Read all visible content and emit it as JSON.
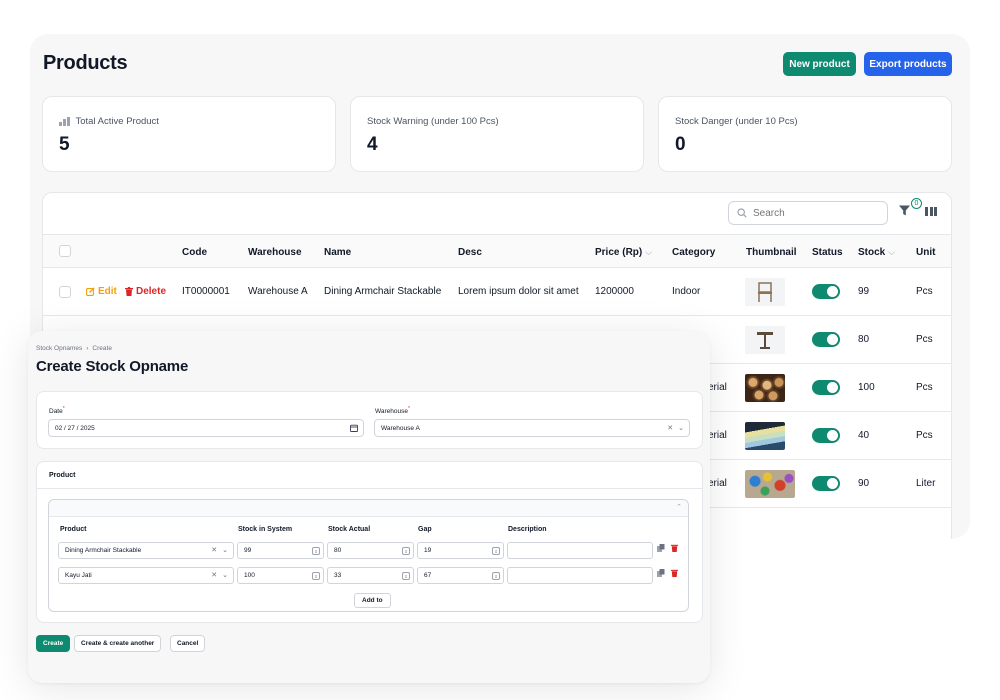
{
  "products_page": {
    "title": "Products",
    "new_button": "New product",
    "export_button": "Export products",
    "stats": [
      {
        "label": "Total Active Product",
        "value": "5",
        "icon": "bar-chart-icon"
      },
      {
        "label": "Stock Warning (under 100 Pcs)",
        "value": "4"
      },
      {
        "label": "Stock Danger (under 10 Pcs)",
        "value": "0"
      }
    ],
    "search_placeholder": "Search",
    "filter_count": "0",
    "columns": [
      "Code",
      "Warehouse",
      "Name",
      "Desc",
      "Price (Rp)",
      "Category",
      "Thumbnail",
      "Status",
      "Stock",
      "Unit"
    ],
    "row_actions": {
      "edit": "Edit",
      "delete": "Delete"
    },
    "rows": [
      {
        "code": "IT0000001",
        "warehouse": "Warehouse A",
        "name": "Dining Armchair Stackable",
        "desc": "Lorem ipsum dolor sit amet",
        "price": "1200000",
        "category": "Indoor",
        "status_on": true,
        "stock": "99",
        "unit": "Pcs"
      },
      {
        "category_partial": "",
        "status_on": true,
        "stock": "80",
        "unit": "Pcs"
      },
      {
        "category_partial": "erial",
        "status_on": true,
        "stock": "100",
        "unit": "Pcs"
      },
      {
        "category_partial": "erial",
        "status_on": true,
        "stock": "40",
        "unit": "Pcs"
      },
      {
        "category_partial": "erial",
        "status_on": true,
        "stock": "90",
        "unit": "Liter"
      }
    ]
  },
  "create_page": {
    "breadcrumb": [
      "Stock Opnames",
      "Create"
    ],
    "title": "Create Stock Opname",
    "date_label": "Date",
    "date_value": "02 / 27 / 2025",
    "warehouse_label": "Warehouse",
    "warehouse_value": "Warehouse A",
    "product_section": "Product",
    "columns": [
      "Product",
      "Stock in System",
      "Stock Actual",
      "Gap",
      "Description"
    ],
    "items": [
      {
        "product": "Dining Armchair Stackable",
        "stock_system": "99",
        "stock_actual": "80",
        "gap": "19",
        "description": ""
      },
      {
        "product": "Kayu Jati",
        "stock_system": "100",
        "stock_actual": "33",
        "gap": "67",
        "description": ""
      }
    ],
    "add_button": "Add to",
    "buttons": {
      "create": "Create",
      "create_another": "Create & create another",
      "cancel": "Cancel"
    }
  },
  "colors": {
    "primary_green": "#0d8a6f",
    "primary_blue": "#2563eb",
    "danger": "#dc2626",
    "warning": "#f59e0b"
  }
}
